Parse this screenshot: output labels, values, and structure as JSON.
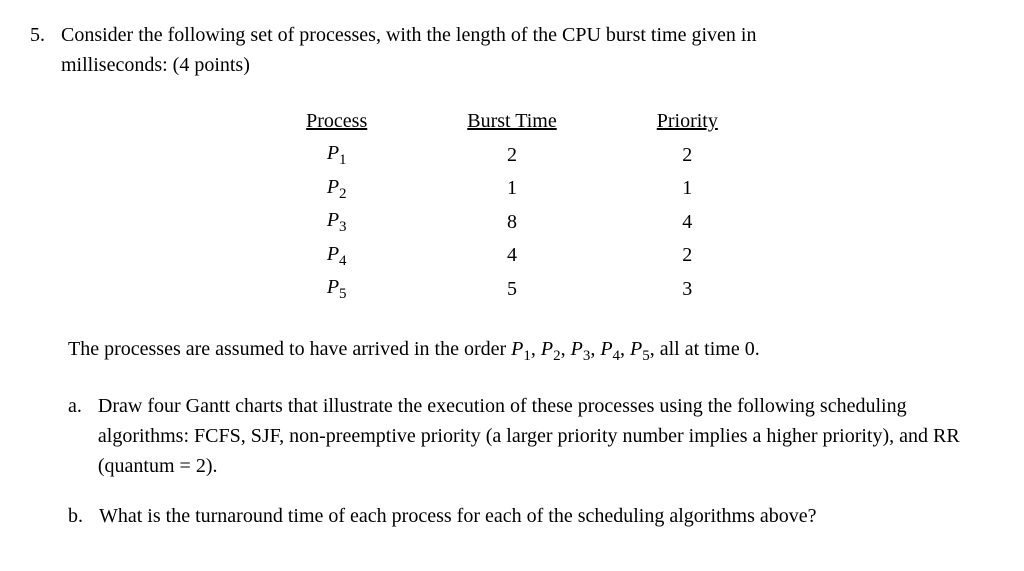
{
  "question": {
    "number": "5.",
    "text_line1": "Consider the following set of processes, with the length of the CPU burst time given in",
    "text_line2": "milliseconds:    (4 points)"
  },
  "table": {
    "headers": {
      "process": "Process",
      "burst": "Burst Time",
      "priority": "Priority"
    },
    "rows": [
      {
        "process_prefix": "P",
        "process_sub": "1",
        "burst": "2",
        "priority": "2"
      },
      {
        "process_prefix": "P",
        "process_sub": "2",
        "burst": "1",
        "priority": "1"
      },
      {
        "process_prefix": "P",
        "process_sub": "3",
        "burst": "8",
        "priority": "4"
      },
      {
        "process_prefix": "P",
        "process_sub": "4",
        "burst": "4",
        "priority": "2"
      },
      {
        "process_prefix": "P",
        "process_sub": "5",
        "burst": "5",
        "priority": "3"
      }
    ]
  },
  "arrival_text": {
    "prefix": "The processes are assumed to have arrived in the order ",
    "p1_p": "P",
    "p1_s": "1",
    "c1": ", ",
    "p2_p": "P",
    "p2_s": "2",
    "c2": ", ",
    "p3_p": "P",
    "p3_s": "3",
    "c3": ", ",
    "p4_p": "P",
    "p4_s": "4",
    "c4": ", ",
    "p5_p": "P",
    "p5_s": "5",
    "c5": ", ",
    "suffix": "all at time 0."
  },
  "parts": {
    "a": {
      "letter": "a.",
      "text": "Draw four Gantt charts that illustrate the execution of these processes using the following scheduling algorithms: FCFS, SJF, non-preemptive priority (a larger priority number implies a higher priority), and RR (quantum = 2)."
    },
    "b": {
      "letter": "b.",
      "text": "What is the turnaround time of each process for each of the scheduling algorithms above?"
    }
  }
}
